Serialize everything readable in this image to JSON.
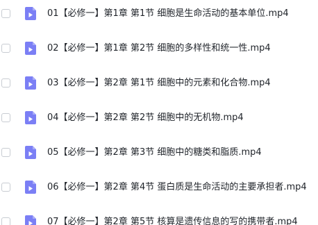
{
  "file_list": {
    "item_icon": "video-file-icon",
    "accent_color": "#7b7ff5",
    "items": [
      {
        "name": "01【必修一】第1章 第1节 细胞是生命活动的基本单位.mp4",
        "checked": false
      },
      {
        "name": "02【必修一】第1章  第2节 细胞的多样性和统一性.mp4",
        "checked": false
      },
      {
        "name": "03【必修一】第2章  第1节 细胞中的元素和化合物.mp4",
        "checked": false
      },
      {
        "name": "04【必修一】第2章  第2节 细胞中的无机物.mp4",
        "checked": false
      },
      {
        "name": "05【必修一】第2章  第3节 细胞中的糖类和脂质.mp4",
        "checked": false
      },
      {
        "name": "06【必修一】第2章  第4节 蛋白质是生命活动的主要承担者.mp4",
        "checked": false
      },
      {
        "name": "07【必修一】第2章  第5节 核算是遗传信息的写的携带者.mp4",
        "checked": false
      }
    ]
  }
}
